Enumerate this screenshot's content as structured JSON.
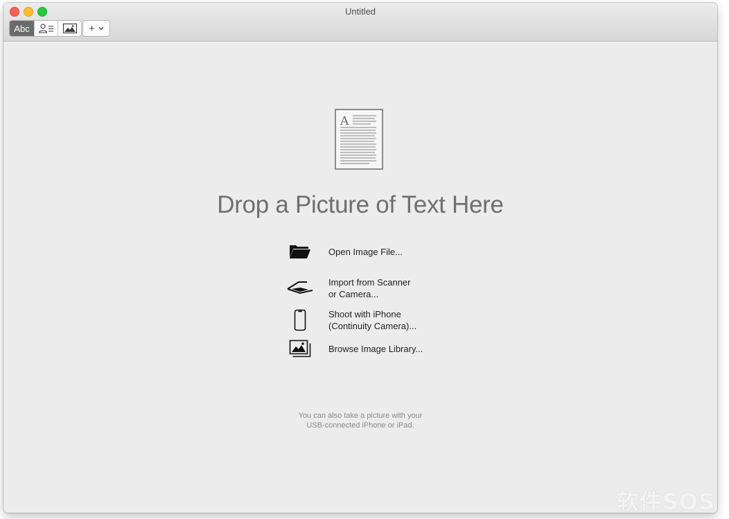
{
  "window": {
    "title": "Untitled"
  },
  "toolbar": {
    "segments": [
      {
        "label": "Abc",
        "icon": "text-mode-icon",
        "selected": true
      },
      {
        "label": "",
        "icon": "contact-mode-icon",
        "selected": false
      },
      {
        "label": "",
        "icon": "image-mode-icon",
        "selected": false
      }
    ],
    "add_button_label": "+"
  },
  "main": {
    "drop_title": "Drop a Picture of Text Here",
    "actions": [
      {
        "icon": "folder-icon",
        "line1": "Open Image File...",
        "line2": ""
      },
      {
        "icon": "scanner-icon",
        "line1": "Import from Scanner",
        "line2": "or Camera..."
      },
      {
        "icon": "iphone-icon",
        "line1": "Shoot with iPhone",
        "line2": "(Continuity Camera)..."
      },
      {
        "icon": "photo-library-icon",
        "line1": "Browse Image Library...",
        "line2": ""
      }
    ],
    "hint_line1": "You can also take a picture with your",
    "hint_line2": "USB-connected iPhone or iPad."
  },
  "watermark": "软件SOS",
  "colors": {
    "close": "#fe5f57",
    "minimize": "#febc2e",
    "maximize": "#28c840",
    "selected_segment": "#6b6b6b"
  }
}
